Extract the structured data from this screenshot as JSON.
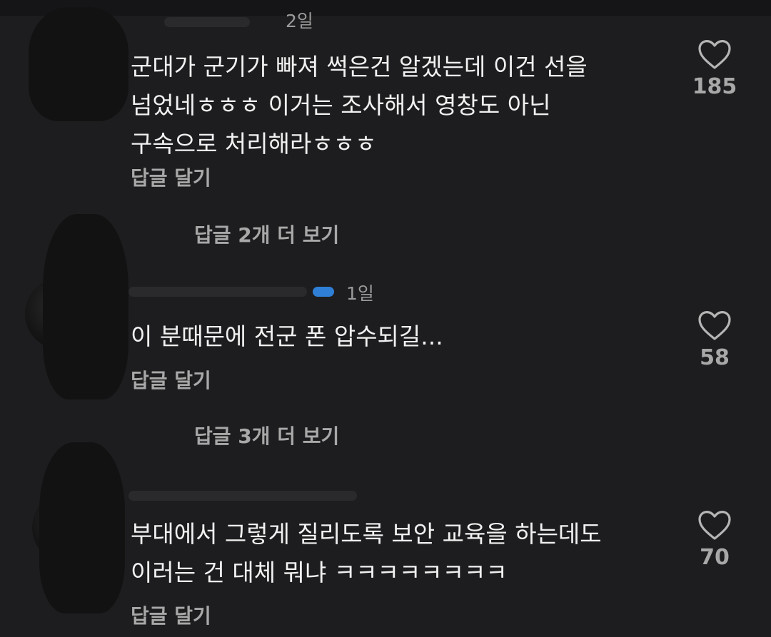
{
  "colors": {
    "background": "#1d1d1f",
    "text_primary": "#f1f1f1",
    "text_secondary": "#a8a8a8",
    "story_ring": "#f5a623"
  },
  "comments": [
    {
      "meta_time": "2일",
      "text": "군대가 군기가 빠져 썩은건 알겠는데 이건 선을\n넘었네ㅎㅎㅎ 이거는 조사해서 영창도 아닌\n구속으로 처리해라ㅎㅎㅎ",
      "reply_label": "답글 달기",
      "likes": "185",
      "like_icon": "heart-icon",
      "more_replies": "답글 2개 더 보기"
    },
    {
      "meta_time": "1일",
      "text": "이 분때문에 전군 폰 압수되길...",
      "reply_label": "답글 달기",
      "likes": "58",
      "like_icon": "heart-icon",
      "more_replies": "답글 3개 더 보기"
    },
    {
      "meta_time": "",
      "text": "부대에서 그렇게 질리도록 보안 교육을 하는데도\n이러는 건 대체 뭐냐 ㅋㅋㅋㅋㅋㅋㅋㅋ",
      "reply_label": "답글 달기",
      "likes": "70",
      "like_icon": "heart-icon",
      "more_replies": ""
    }
  ]
}
